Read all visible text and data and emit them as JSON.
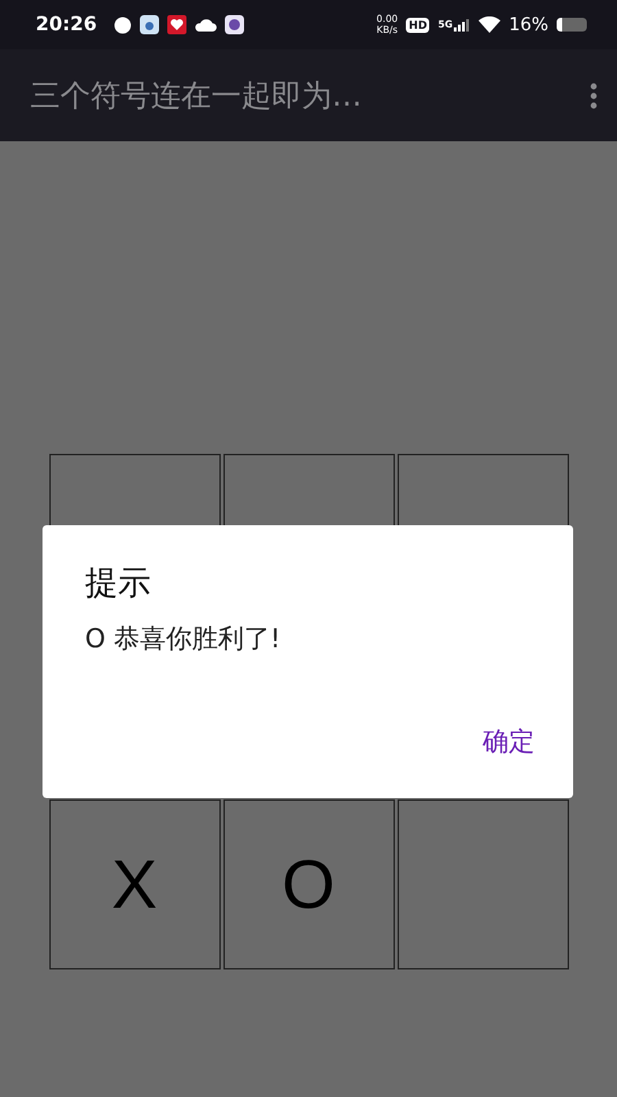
{
  "status_bar": {
    "time": "20:26",
    "net_speed": "0.00",
    "net_unit": "KB/s",
    "hd": "HD",
    "network": "5G",
    "battery": "16%"
  },
  "app_bar": {
    "title": "三个符号连在一起即为…"
  },
  "board": {
    "bottom_row": [
      {
        "symbol": "X"
      },
      {
        "symbol": "O"
      }
    ]
  },
  "dialog": {
    "title": "提示",
    "message": "O 恭喜你胜利了!",
    "button": "确定"
  }
}
